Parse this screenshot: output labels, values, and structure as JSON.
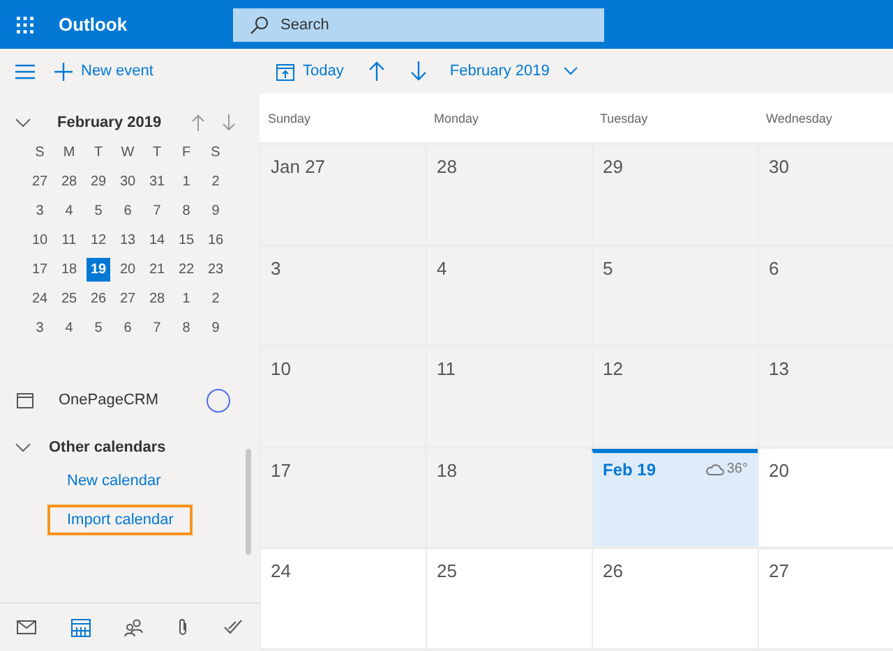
{
  "header": {
    "app_name": "Outlook",
    "search": {
      "placeholder": "Search"
    }
  },
  "sidebar": {
    "new_event": "New event",
    "mini_calendar": {
      "month": "February 2019",
      "expanded": true,
      "weekdays": [
        "S",
        "M",
        "T",
        "W",
        "T",
        "F",
        "S"
      ],
      "weeks": [
        [
          {
            "day": "27",
            "selected": false
          },
          {
            "day": "28",
            "selected": false
          },
          {
            "day": "29",
            "selected": false
          },
          {
            "day": "30",
            "selected": false
          },
          {
            "day": "31",
            "selected": false
          },
          {
            "day": "1",
            "selected": false
          },
          {
            "day": "2",
            "selected": false
          }
        ],
        [
          {
            "day": "3",
            "selected": false
          },
          {
            "day": "4",
            "selected": false
          },
          {
            "day": "5",
            "selected": false
          },
          {
            "day": "6",
            "selected": false
          },
          {
            "day": "7",
            "selected": false
          },
          {
            "day": "8",
            "selected": false
          },
          {
            "day": "9",
            "selected": false
          }
        ],
        [
          {
            "day": "10",
            "selected": false
          },
          {
            "day": "11",
            "selected": false
          },
          {
            "day": "12",
            "selected": false
          },
          {
            "day": "13",
            "selected": false
          },
          {
            "day": "14",
            "selected": false
          },
          {
            "day": "15",
            "selected": false
          },
          {
            "day": "16",
            "selected": false
          }
        ],
        [
          {
            "day": "17",
            "selected": false
          },
          {
            "day": "18",
            "selected": false
          },
          {
            "day": "19",
            "selected": true
          },
          {
            "day": "20",
            "selected": false
          },
          {
            "day": "21",
            "selected": false
          },
          {
            "day": "22",
            "selected": false
          },
          {
            "day": "23",
            "selected": false
          }
        ],
        [
          {
            "day": "24",
            "selected": false
          },
          {
            "day": "25",
            "selected": false
          },
          {
            "day": "26",
            "selected": false
          },
          {
            "day": "27",
            "selected": false
          },
          {
            "day": "28",
            "selected": false
          },
          {
            "day": "1",
            "selected": false
          },
          {
            "day": "2",
            "selected": false
          }
        ],
        [
          {
            "day": "3",
            "selected": false
          },
          {
            "day": "4",
            "selected": false
          },
          {
            "day": "5",
            "selected": false
          },
          {
            "day": "6",
            "selected": false
          },
          {
            "day": "7",
            "selected": false
          },
          {
            "day": "8",
            "selected": false
          },
          {
            "day": "9",
            "selected": false
          }
        ]
      ]
    },
    "calendars": [
      {
        "name": "OnePageCRM",
        "color": "#4f6bed"
      }
    ],
    "other_calendars": {
      "title": "Other calendars",
      "expanded": true,
      "links": [
        {
          "label": "New calendar",
          "highlighted": false
        },
        {
          "label": "Import calendar",
          "highlighted": true
        }
      ]
    },
    "nav": [
      {
        "kind": "mail",
        "selected": false
      },
      {
        "kind": "calendar",
        "selected": true
      },
      {
        "kind": "people",
        "selected": false
      },
      {
        "kind": "files",
        "selected": false
      },
      {
        "kind": "tasks",
        "selected": false
      }
    ]
  },
  "toolbar": {
    "today": "Today",
    "period": "February 2019"
  },
  "calendar": {
    "days": [
      "Sunday",
      "Monday",
      "Tuesday",
      "Wednesday"
    ],
    "weeks": [
      [
        {
          "label": "Jan 27",
          "past": true,
          "today": false
        },
        {
          "label": "28",
          "past": true,
          "today": false
        },
        {
          "label": "29",
          "past": true,
          "today": false
        },
        {
          "label": "30",
          "past": true,
          "today": false
        }
      ],
      [
        {
          "label": "3",
          "past": true,
          "today": false
        },
        {
          "label": "4",
          "past": true,
          "today": false
        },
        {
          "label": "5",
          "past": true,
          "today": false
        },
        {
          "label": "6",
          "past": true,
          "today": false
        }
      ],
      [
        {
          "label": "10",
          "past": true,
          "today": false
        },
        {
          "label": "11",
          "past": true,
          "today": false
        },
        {
          "label": "12",
          "past": true,
          "today": false
        },
        {
          "label": "13",
          "past": true,
          "today": false
        }
      ],
      [
        {
          "label": "17",
          "past": true,
          "today": false
        },
        {
          "label": "18",
          "past": true,
          "today": false
        },
        {
          "label": "Feb 19",
          "past": false,
          "today": true,
          "weather": "36°"
        },
        {
          "label": "20",
          "past": false,
          "today": false
        }
      ],
      [
        {
          "label": "24",
          "past": false,
          "today": false
        },
        {
          "label": "25",
          "past": false,
          "today": false
        },
        {
          "label": "26",
          "past": false,
          "today": false
        },
        {
          "label": "27",
          "past": false,
          "today": false
        }
      ]
    ]
  }
}
